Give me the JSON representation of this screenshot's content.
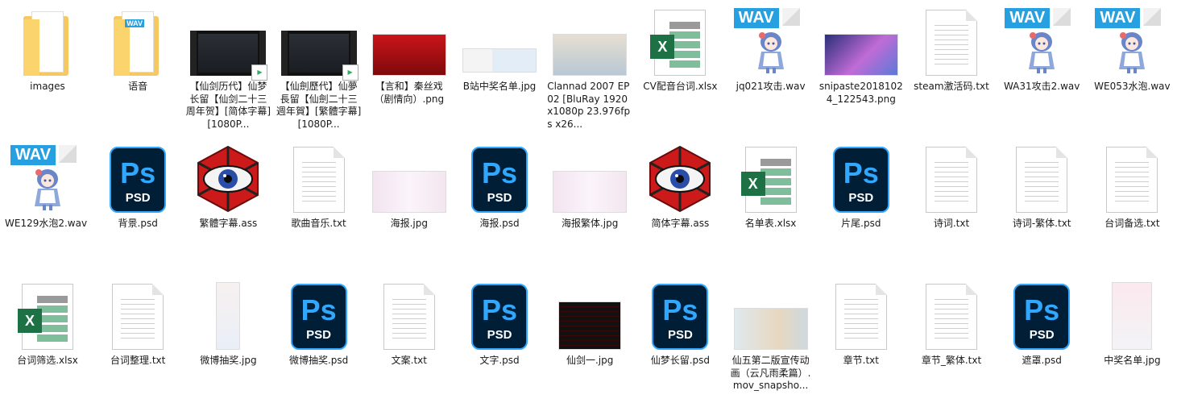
{
  "files": [
    {
      "label": "images",
      "icon": "folder"
    },
    {
      "label": "语音",
      "icon": "folder-audio"
    },
    {
      "label": "【仙剑历代】仙梦长留【仙剑二十三周年贺】[简体字幕][1080P...",
      "icon": "video"
    },
    {
      "label": "【仙劍歷代】仙夢長留【仙劍二十三週年賀】[繁體字幕][1080P...",
      "icon": "video"
    },
    {
      "label": "【言和】秦丝戏（剧情向）.png",
      "icon": "image-red"
    },
    {
      "label": "B站中奖名单.jpg",
      "icon": "image-screenshot"
    },
    {
      "label": "Clannad 2007 EP02 [BluRay 1920x1080p 23.976fps x26...",
      "icon": "image-anime",
      "align": "left"
    },
    {
      "label": "CV配音台词.xlsx",
      "icon": "xlsx"
    },
    {
      "label": "jq021攻击.wav",
      "icon": "wav"
    },
    {
      "label": "snipaste20181024_122543.png",
      "icon": "image-purple"
    },
    {
      "label": "steam激活码.txt",
      "icon": "txt"
    },
    {
      "label": "WA31攻击2.wav",
      "icon": "wav"
    },
    {
      "label": "WE053水泡.wav",
      "icon": "wav"
    },
    {
      "label": "WE129水泡2.wav",
      "icon": "wav",
      "align": "left"
    },
    {
      "label": "背景.psd",
      "icon": "psd"
    },
    {
      "label": "繁體字幕.ass",
      "icon": "eye"
    },
    {
      "label": "歌曲音乐.txt",
      "icon": "txt"
    },
    {
      "label": "海报.jpg",
      "icon": "image-pink"
    },
    {
      "label": "海报.psd",
      "icon": "psd"
    },
    {
      "label": "海报繁体.jpg",
      "icon": "image-pink"
    },
    {
      "label": "简体字幕.ass",
      "icon": "eye"
    },
    {
      "label": "名单表.xlsx",
      "icon": "xlsx"
    },
    {
      "label": "片尾.psd",
      "icon": "psd"
    },
    {
      "label": "诗词.txt",
      "icon": "txt"
    },
    {
      "label": "诗词-繁体.txt",
      "icon": "txt"
    },
    {
      "label": "台词备选.txt",
      "icon": "txt"
    },
    {
      "label": "台词筛选.xlsx",
      "icon": "xlsx"
    },
    {
      "label": "台词整理.txt",
      "icon": "txt"
    },
    {
      "label": "微博抽奖.jpg",
      "icon": "image-tall"
    },
    {
      "label": "微博抽奖.psd",
      "icon": "psd"
    },
    {
      "label": "文案.txt",
      "icon": "txt"
    },
    {
      "label": "文字.psd",
      "icon": "psd"
    },
    {
      "label": "仙剑一.jpg",
      "icon": "image-dark"
    },
    {
      "label": "仙梦长留.psd",
      "icon": "psd"
    },
    {
      "label": "仙五第二版宣传动画（云凡雨柔篇）.mov_snapsho...",
      "icon": "image-portrait"
    },
    {
      "label": "章节.txt",
      "icon": "txt"
    },
    {
      "label": "章节_繁体.txt",
      "icon": "txt"
    },
    {
      "label": "遮罩.psd",
      "icon": "psd"
    },
    {
      "label": "中奖名单.jpg",
      "icon": "image-tall2"
    }
  ],
  "icon_text": {
    "psd_glyph": "Ps",
    "psd_ext": "PSD",
    "wav_tag": "WAV",
    "xlsx_badge": "X"
  },
  "colors": {
    "psd_bg": "#001e36",
    "psd_accent": "#31a8ff",
    "xlsx_green": "#1e7145",
    "wav_blue": "#26a0e0",
    "folder_yellow": "#f5c861"
  }
}
